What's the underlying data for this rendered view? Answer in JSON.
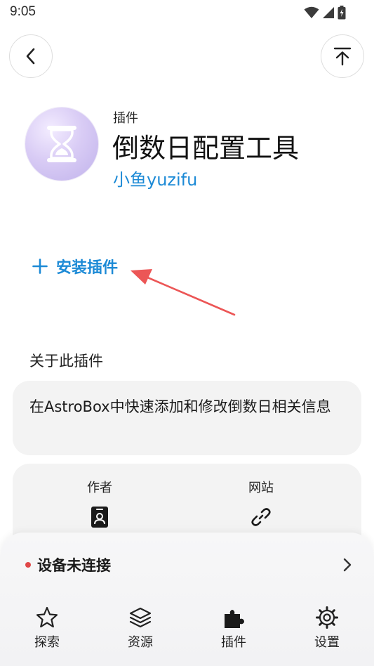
{
  "status_bar": {
    "time": "9:05",
    "icons": [
      "wifi-icon",
      "signal-icon",
      "battery-charging-icon"
    ]
  },
  "header": {
    "back_icon": "chevron-left-icon",
    "top_icon": "arrow-up-to-top-icon"
  },
  "plugin": {
    "icon": "hourglass-icon",
    "type_label": "插件",
    "title": "倒数日配置工具",
    "author": "小鱼yuzifu"
  },
  "install": {
    "icon": "plus-icon",
    "label": "安装插件"
  },
  "about": {
    "section_title": "关于此插件",
    "description": "在AstroBox中快速添加和修改倒数日相关信息",
    "author_label": "作者",
    "author_icon": "contact-card-icon",
    "website_label": "网站",
    "website_icon": "link-icon"
  },
  "device": {
    "status_text": "设备未连接",
    "status_color": "#e04848"
  },
  "tabs": [
    {
      "label": "探索",
      "icon": "star-icon"
    },
    {
      "label": "资源",
      "icon": "layers-icon"
    },
    {
      "label": "插件",
      "icon": "puzzle-icon"
    },
    {
      "label": "设置",
      "icon": "gear-icon"
    }
  ],
  "colors": {
    "accent": "#1c8ad6",
    "annotation_arrow": "#ec5656"
  }
}
